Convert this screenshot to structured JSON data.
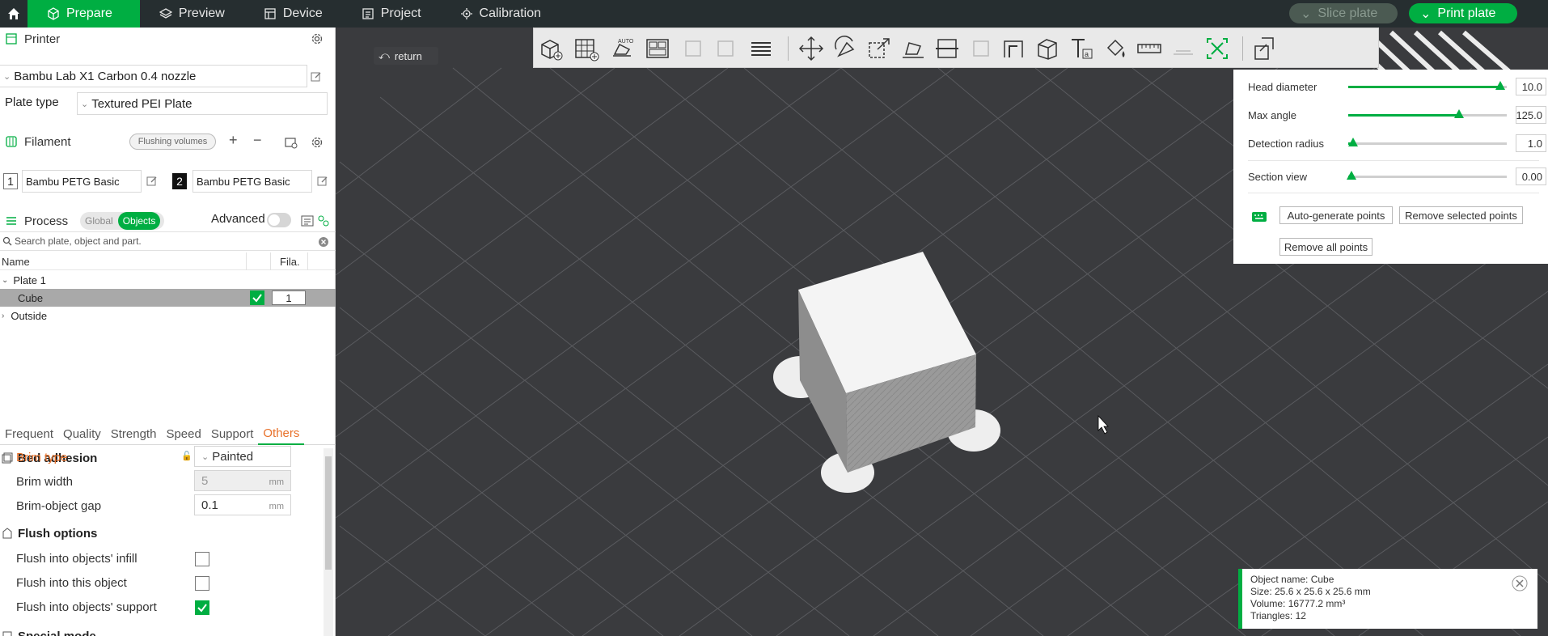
{
  "topbar": {
    "tabs": [
      {
        "label": "Prepare",
        "icon": "cube-icon",
        "active": true
      },
      {
        "label": "Preview",
        "icon": "layers-icon",
        "active": false
      },
      {
        "label": "Device",
        "icon": "device-icon",
        "active": false
      },
      {
        "label": "Project",
        "icon": "project-icon",
        "active": false
      },
      {
        "label": "Calibration",
        "icon": "calibration-icon",
        "active": false
      }
    ],
    "slice_label": "Slice plate",
    "print_label": "Print plate"
  },
  "printer": {
    "header": "Printer",
    "name": "Bambu Lab X1 Carbon 0.4 nozzle",
    "plate_type_label": "Plate type",
    "plate_type_value": "Textured PEI Plate"
  },
  "filament": {
    "header": "Filament",
    "flushing_label": "Flushing volumes",
    "slots": [
      {
        "index": "1",
        "name": "Bambu PETG Basic"
      },
      {
        "index": "2",
        "name": "Bambu PETG Basic"
      }
    ]
  },
  "process": {
    "header": "Process",
    "global_label": "Global",
    "objects_label": "Objects",
    "advanced_label": "Advanced",
    "search_placeholder": "Search plate, object and part.",
    "col_name": "Name",
    "col_fila": "Fila.",
    "tree": {
      "plate": "Plate 1",
      "object": "Cube",
      "object_filament": "1",
      "outside": "Outside"
    }
  },
  "settings_tabs": [
    "Frequent",
    "Quality",
    "Strength",
    "Speed",
    "Support",
    "Others"
  ],
  "settings": {
    "bed_adhesion": "Bed adhesion",
    "brim_type_label": "Brim type",
    "brim_type_value": "Painted",
    "brim_width_label": "Brim width",
    "brim_width_value": "5",
    "brim_gap_label": "Brim-object gap",
    "brim_gap_value": "0.1",
    "unit": "mm",
    "flush_options": "Flush options",
    "flush_infill_label": "Flush into objects' infill",
    "flush_object_label": "Flush into this object",
    "flush_support_label": "Flush into objects' support",
    "special_mode": "Special mode"
  },
  "viewport": {
    "return_label": "return"
  },
  "support_panel": {
    "head_diameter_label": "Head diameter",
    "head_diameter_value": "10.0",
    "head_diameter_level": 0.96,
    "max_angle_label": "Max angle",
    "max_angle_value": "125.0",
    "max_angle_level": 0.7,
    "detection_radius_label": "Detection radius",
    "detection_radius_value": "1.0",
    "detection_radius_level": 0.03,
    "section_view_label": "Section view",
    "section_view_value": "0.00",
    "section_view_level": 0.02,
    "auto_generate_label": "Auto-generate points",
    "remove_selected_label": "Remove selected points",
    "remove_all_label": "Remove all points"
  },
  "info": {
    "name": "Object name: Cube",
    "size": "Size: 25.6 x 25.6 x 25.6 mm",
    "volume": "Volume: 16777.2 mm³",
    "triangles": "Triangles: 12"
  },
  "colors": {
    "accent": "#00ae42",
    "warn": "#e8712a",
    "bed": "#3a3b3e",
    "topbar": "#262e30"
  }
}
